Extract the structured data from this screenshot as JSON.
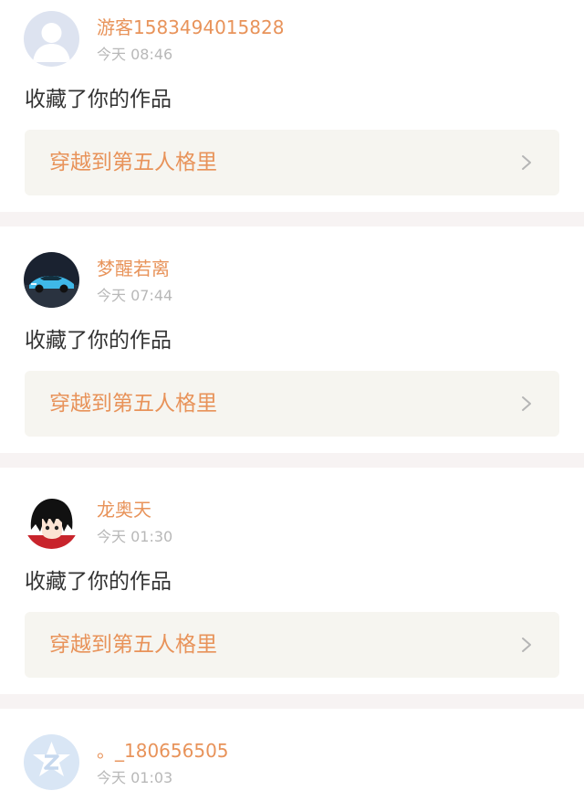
{
  "notifications": [
    {
      "username": "游客1583494015828",
      "time": "今天 08:46",
      "action": "收藏了你的作品",
      "work_title": "穿越到第五人格里",
      "avatar_icon": "default-user-icon"
    },
    {
      "username": "梦醒若离",
      "time": "今天 07:44",
      "action": "收藏了你的作品",
      "work_title": "穿越到第五人格里",
      "avatar_icon": "car-avatar-icon"
    },
    {
      "username": "龙奥天",
      "time": "今天 01:30",
      "action": "收藏了你的作品",
      "work_title": "穿越到第五人格里",
      "avatar_icon": "anime-boy-avatar-icon"
    },
    {
      "username": "。_180656505",
      "time": "今天 01:03",
      "action": "",
      "work_title": "",
      "avatar_icon": "z-logo-avatar-icon"
    }
  ],
  "colors": {
    "accent": "#e8935a",
    "time": "#b8b8b8",
    "text": "#333333",
    "link_bg": "#f6f5f0",
    "separator": "#f7f3f3"
  }
}
